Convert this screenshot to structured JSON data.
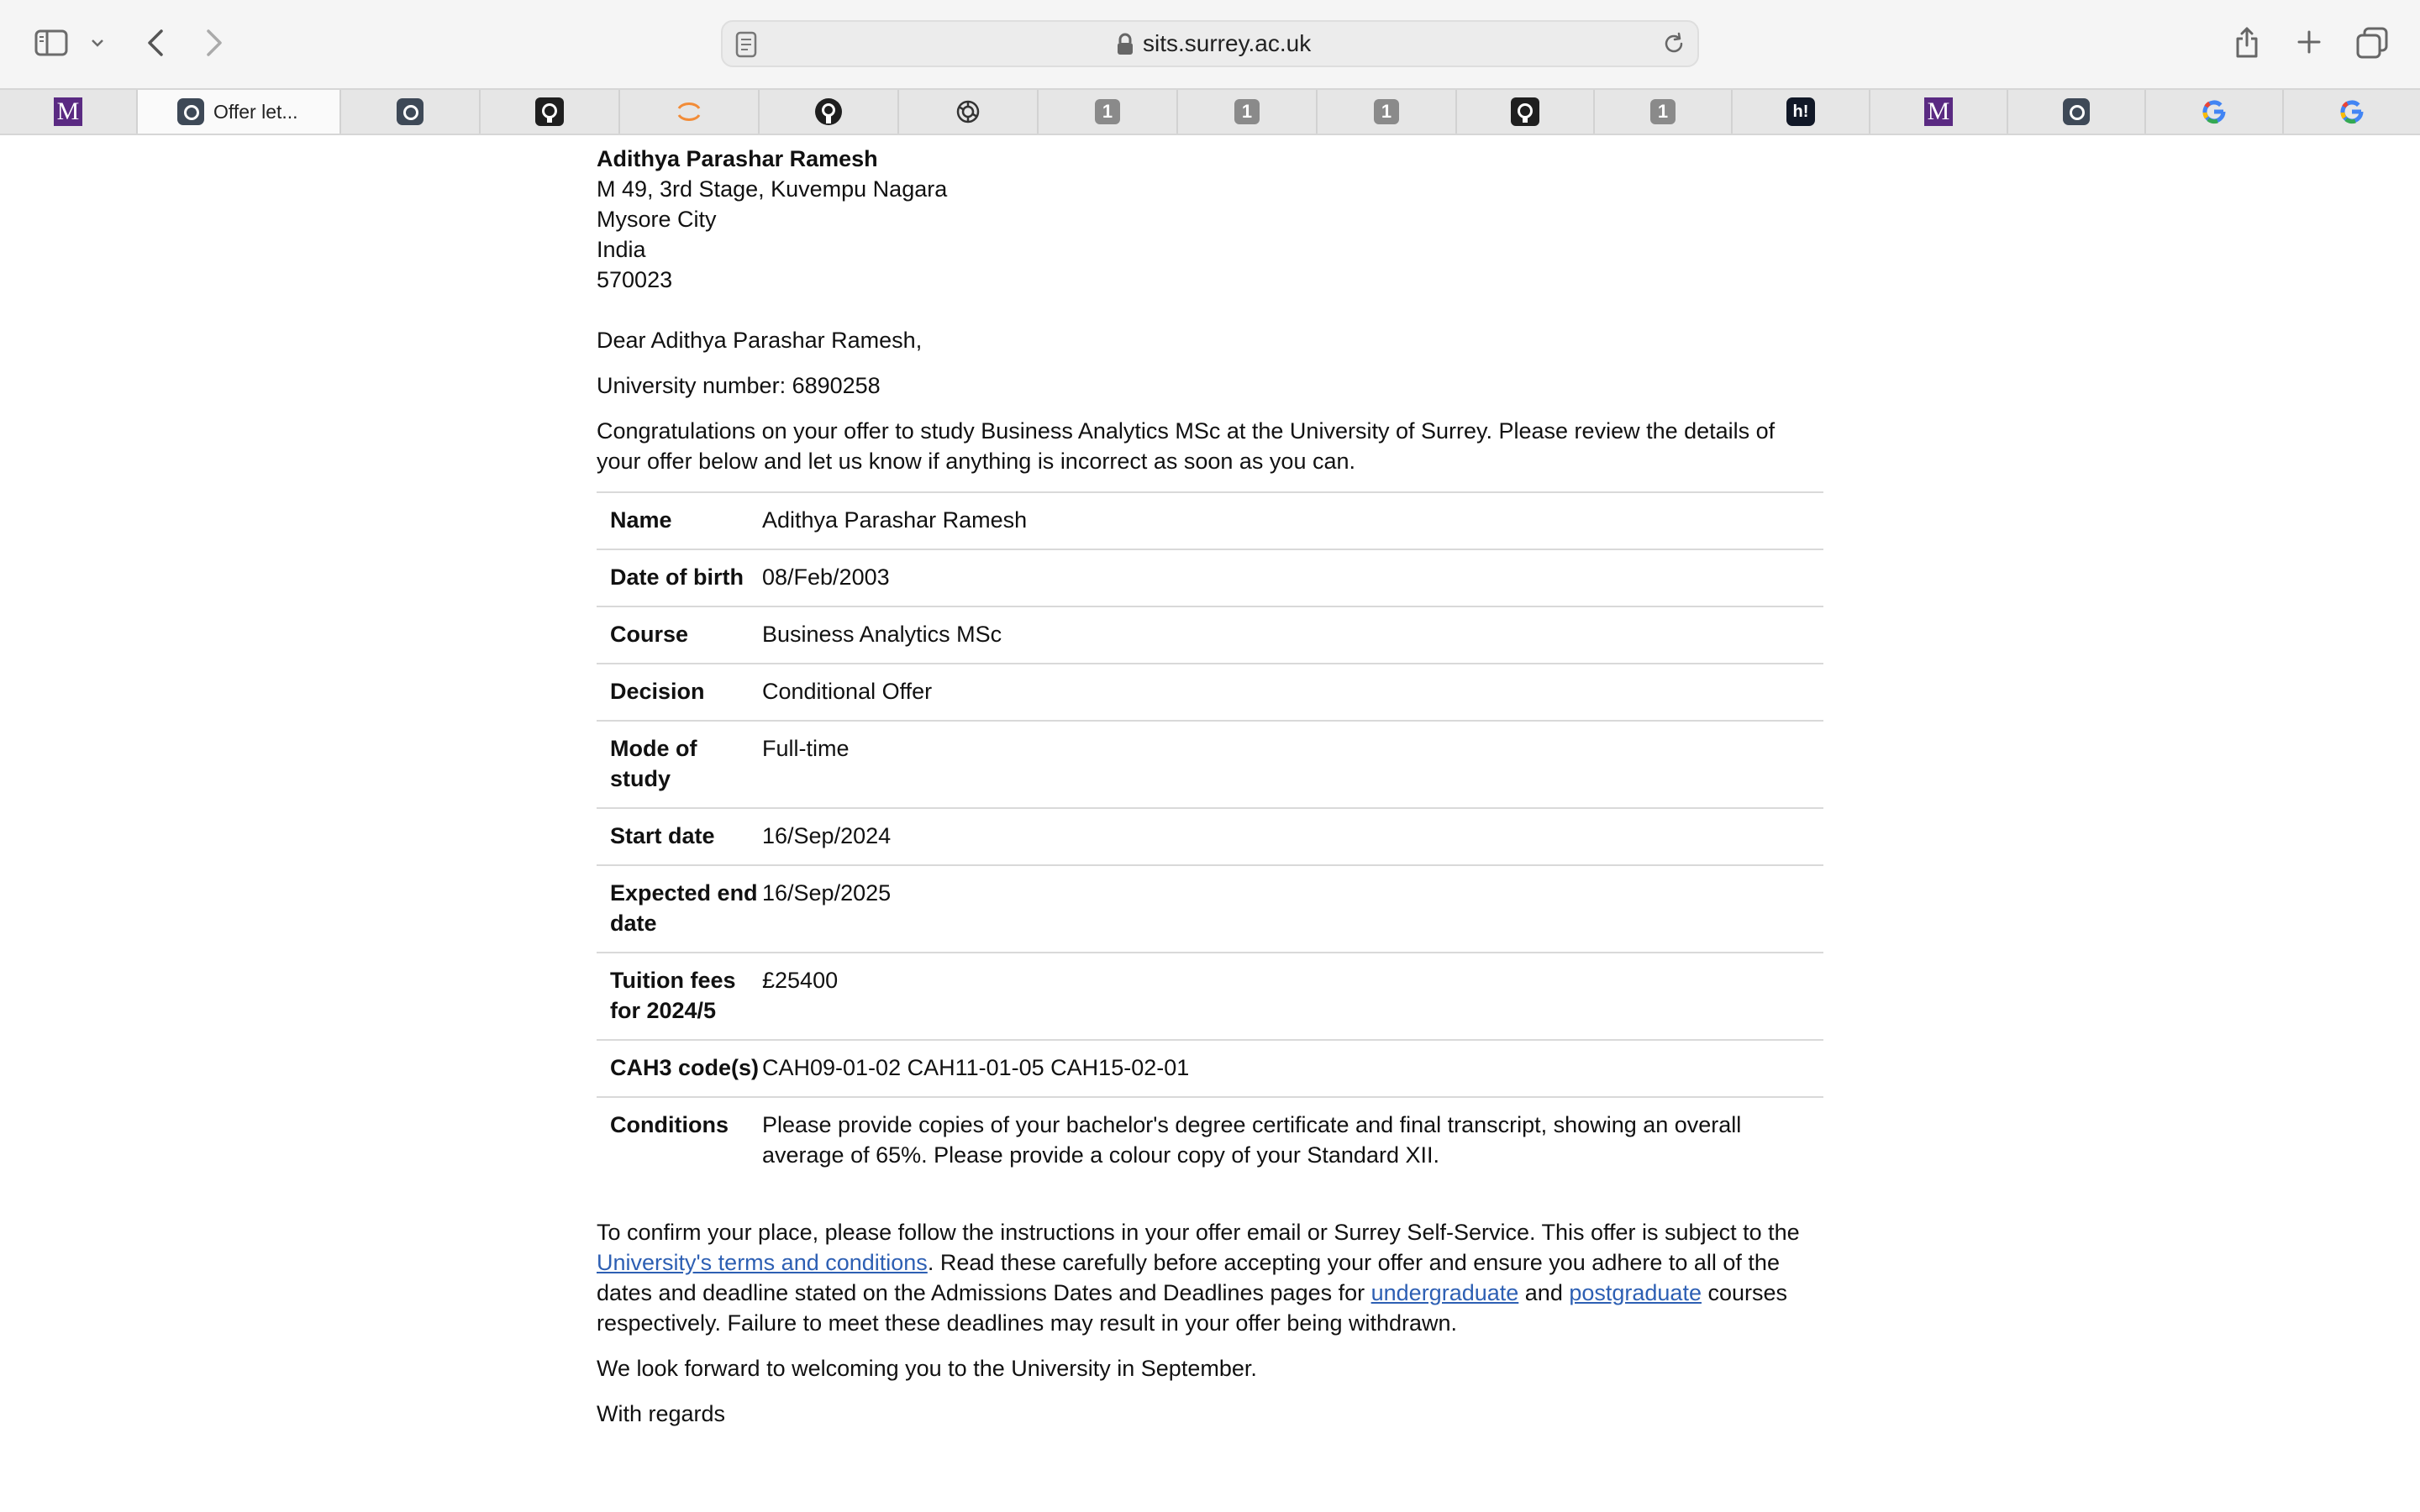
{
  "browser": {
    "url": "sits.surrey.ac.uk",
    "tabs": [
      {
        "icon": "m-logo-icon",
        "label": "M"
      },
      {
        "icon": "surrey-favicon-icon",
        "title": "Offer let...",
        "active": true
      },
      {
        "icon": "surrey-favicon-icon"
      },
      {
        "icon": "github-icon"
      },
      {
        "icon": "loading-spinner-icon"
      },
      {
        "icon": "github-icon"
      },
      {
        "icon": "openai-icon"
      },
      {
        "icon": "badge-icon",
        "label": "1"
      },
      {
        "icon": "badge-icon",
        "label": "1"
      },
      {
        "icon": "badge-icon",
        "label": "1"
      },
      {
        "icon": "github-icon"
      },
      {
        "icon": "badge-icon",
        "label": "1"
      },
      {
        "icon": "h-logo-icon",
        "label": "h!"
      },
      {
        "icon": "m-logo-icon",
        "label": "M"
      },
      {
        "icon": "surrey-favicon-icon"
      },
      {
        "icon": "google-icon"
      },
      {
        "icon": "google-icon"
      }
    ]
  },
  "letter": {
    "address": {
      "name": "Adithya Parashar Ramesh",
      "line1": "M 49, 3rd Stage, Kuvempu Nagara",
      "line2": "Mysore City",
      "line3": "India",
      "line4": "570023"
    },
    "greeting": "Dear Adithya Parashar Ramesh,",
    "university_number": "University number: 6890258",
    "intro": "Congratulations on your offer to study Business Analytics MSc at the University of Surrey. Please review the details of your offer below and let us know if anything is incorrect as soon as you can.",
    "details": [
      {
        "key": "Name",
        "value": "Adithya Parashar Ramesh"
      },
      {
        "key": "Date of birth",
        "value": "08/Feb/2003"
      },
      {
        "key": "Course",
        "value": "Business Analytics MSc"
      },
      {
        "key": "Decision",
        "value": "Conditional Offer"
      },
      {
        "key": "Mode of study",
        "value": "Full-time"
      },
      {
        "key": "Start date",
        "value": "16/Sep/2024"
      },
      {
        "key": "Expected end date",
        "value": "16/Sep/2025"
      },
      {
        "key": "Tuition fees for 2024/5",
        "value": "£25400"
      },
      {
        "key": "CAH3 code(s)",
        "value": "CAH09-01-02 CAH11-01-05 CAH15-02-01"
      },
      {
        "key": "Conditions",
        "value": "Please provide copies of your bachelor's degree certificate and final transcript, showing an overall average of 65%. Please provide a colour copy of your Standard XII."
      }
    ],
    "confirm": {
      "part1": "To confirm your place, please follow the instructions in your offer email or Surrey Self-Service. This offer is subject to the ",
      "terms_link": "University's terms and conditions",
      "part2": ". Read these carefully before accepting your offer and ensure you adhere to all of the dates and deadline stated on the Admissions Dates and Deadlines pages for ",
      "ug_link": "undergraduate",
      "part3": " and ",
      "pg_link": "postgraduate",
      "part4": " courses respectively. Failure to meet these deadlines may result in your offer being withdrawn."
    },
    "looking_forward": "We look forward to welcoming you to the University in September.",
    "sign_off": "With regards"
  },
  "colors": {
    "link": "#2d5fb3",
    "toolbar_bg": "#f5f5f5",
    "tabstrip_bg": "#e6e6e6"
  }
}
